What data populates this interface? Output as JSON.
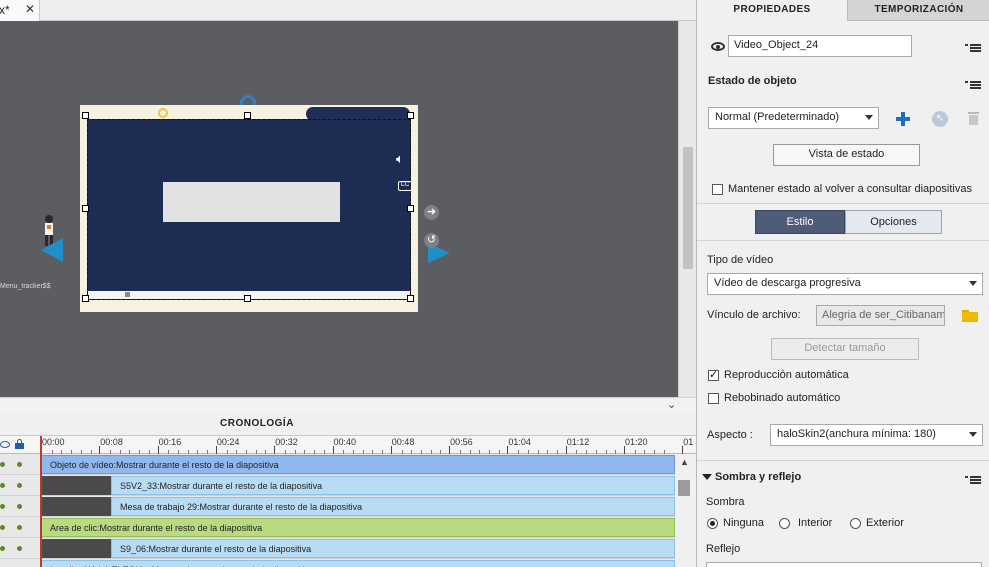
{
  "document_tab": {
    "title": "x*",
    "close": "✕"
  },
  "stage": {
    "menu_tracker_label": "Menu_tracker$$"
  },
  "timeline": {
    "title": "CRONOLOGÍA",
    "ruler": [
      "00:00",
      "00:08",
      "00:16",
      "00:24",
      "00:32",
      "00:40",
      "00:48",
      "00:56",
      "01:04",
      "01:12",
      "01:20",
      "01"
    ],
    "rows": [
      {
        "label": "Objeto de vídeo:Mostrar durante el resto de la diapositiva",
        "color": "blue"
      },
      {
        "label": "S5V2_33:Mostrar durante el resto de la diapositiva",
        "color": "lblue"
      },
      {
        "label": "Mesa de trabajo 29:Mostrar durante el resto de la diapositiva",
        "color": "lblue"
      },
      {
        "label": "Area de clic:Mostrar durante el resto de la diapositiva",
        "color": "green"
      },
      {
        "label": "S9_06:Mostrar durante el resto de la diapositiva",
        "color": "lblue"
      },
      {
        "label": "Inscribe NA LA ELEGIA - Mostrar durante el resto de la diapositiva",
        "color": "lblue"
      }
    ]
  },
  "panel": {
    "tabs": {
      "properties": "PROPIEDADES",
      "timing": "TEMPORIZACIÓN"
    },
    "object_name": "Video_Object_24",
    "object_state": {
      "title": "Estado de objeto",
      "state_value": "Normal (Predeterminado)",
      "state_view_button": "Vista de estado",
      "keep_state_label": "Mantener estado al volver a consultar diapositivas"
    },
    "seg": {
      "style": "Estilo",
      "options": "Opciones"
    },
    "video_type": {
      "label": "Tipo de vídeo",
      "value": "Vídeo de descarga progresiva"
    },
    "file_link": {
      "label": "Vínculo de archivo:",
      "value": "Alegria de ser_Citibaname"
    },
    "detect_size_button": "Detectar tamaño",
    "autoplay": {
      "label": "Reproducción automática",
      "checked": true
    },
    "autorewind": {
      "label": "Rebobinado automático",
      "checked": false
    },
    "aspect": {
      "label": "Aspecto :",
      "value": "haloSkin2(anchura mínima: 180)"
    },
    "shadow_section": {
      "title": "Sombra y reflejo",
      "shadow_label": "Sombra",
      "options": [
        "Ninguna",
        "Interior",
        "Exterior"
      ],
      "selected": "Ninguna",
      "reflection_label": "Reflejo"
    }
  },
  "colors": {
    "stage_bg": "#5c5d61",
    "video_fill": "#1d2c53",
    "accent_blue": "#1e8fc8",
    "playhead": "#c0392b"
  }
}
